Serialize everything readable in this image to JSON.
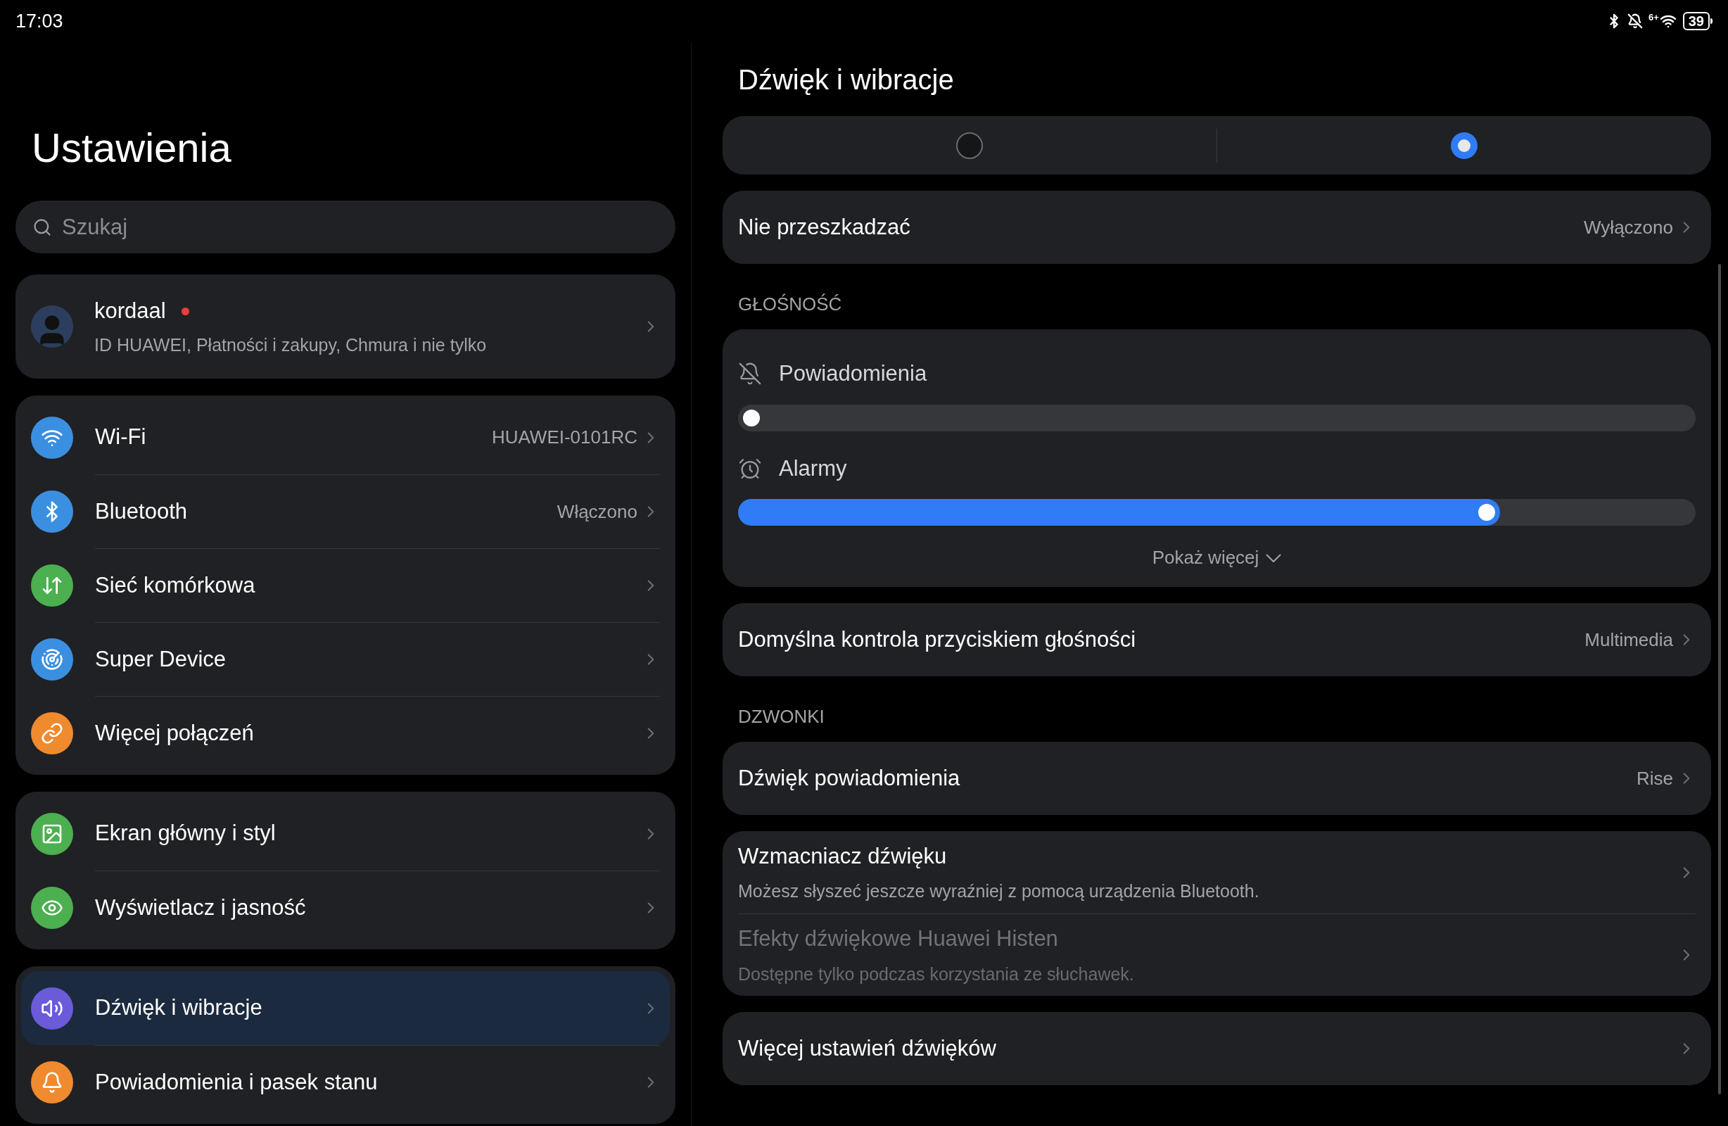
{
  "status_bar": {
    "time": "17:03",
    "wifi_badge": "6+",
    "battery": "39"
  },
  "sidebar": {
    "title": "Ustawienia",
    "search": {
      "placeholder": "Szukaj"
    },
    "account": {
      "name": "kordaal",
      "subtitle": "ID HUAWEI, Płatności i zakupy, Chmura i nie tylko",
      "badge_dot": true
    },
    "groups": [
      [
        {
          "label": "Wi-Fi",
          "value": "HUAWEI-0101RC",
          "color": "#3b8fe0",
          "selected": false
        },
        {
          "label": "Bluetooth",
          "value": "Włączono",
          "color": "#3b8fe0",
          "selected": false
        },
        {
          "label": "Sieć komórkowa",
          "color": "#4caf50",
          "selected": false
        },
        {
          "label": "Super Device",
          "color": "#3b8fe0",
          "selected": false
        },
        {
          "label": "Więcej połączeń",
          "color": "#ef8a2e",
          "selected": false
        }
      ],
      [
        {
          "label": "Ekran główny i styl",
          "color": "#4caf50",
          "selected": false
        },
        {
          "label": "Wyświetlacz i jasność",
          "color": "#4caf50",
          "selected": false
        }
      ],
      [
        {
          "label": "Dźwięk i wibracje",
          "color": "#6b5bd8",
          "selected": true
        },
        {
          "label": "Powiadomienia i pasek stanu",
          "color": "#ef8a2e",
          "selected": false
        }
      ]
    ]
  },
  "detail": {
    "title": "Dźwięk i wibracje",
    "modes": [
      {
        "selected": false
      },
      {
        "selected": true
      }
    ],
    "blocks": [
      {
        "kind": "card",
        "rows": [
          {
            "label": "Nie przeszkadzać",
            "value": "Wyłączono",
            "disabled": false
          }
        ]
      },
      {
        "kind": "header",
        "text": "GŁOŚNOŚĆ"
      },
      {
        "kind": "volume",
        "sliders": [
          {
            "label": "Powiadomienia",
            "muted": true,
            "level": 0
          },
          {
            "label": "Alarmy",
            "muted": false,
            "level": 0.79
          }
        ],
        "show_more": "Pokaż więcej"
      },
      {
        "kind": "card",
        "rows": [
          {
            "label": "Domyślna kontrola przyciskiem głośności",
            "value": "Multimedia",
            "disabled": false
          }
        ]
      },
      {
        "kind": "header",
        "text": "DZWONKI"
      },
      {
        "kind": "card",
        "rows": [
          {
            "label": "Dźwięk powiadomienia",
            "value": "Rise",
            "disabled": false
          }
        ]
      },
      {
        "kind": "card",
        "rows": [
          {
            "label": "Wzmacniacz dźwięku",
            "subtitle": "Możesz słyszeć jeszcze wyraźniej z pomocą urządzenia Bluetooth.",
            "disabled": false
          },
          {
            "label": "Efekty dźwiękowe Huawei Histen",
            "subtitle": "Dostępne tylko podczas korzystania ze słuchawek.",
            "disabled": true
          }
        ]
      },
      {
        "kind": "card",
        "rows": [
          {
            "label": "Więcej ustawień dźwięków",
            "disabled": false
          }
        ]
      }
    ]
  }
}
